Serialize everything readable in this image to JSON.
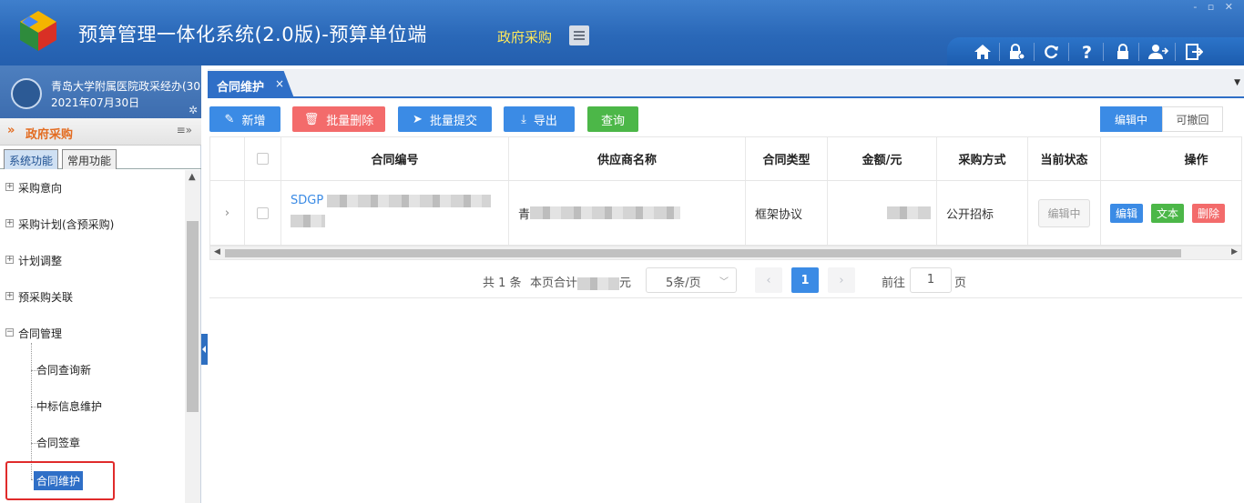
{
  "header": {
    "app_title": "预算管理一体化系统(2.0版)-预算单位端",
    "module_name": "政府采购",
    "window_controls": "- ▫ ✕",
    "toolbar_icons": [
      "home-icon",
      "lock-settings-icon",
      "refresh-icon",
      "help-icon",
      "lock-icon",
      "user-switch-icon",
      "logout-icon"
    ]
  },
  "sidebar": {
    "user_name": "青岛大学附属医院政采经办(30",
    "user_date": "2021年07月30日",
    "section_title": "政府采购",
    "tabs": [
      "系统功能",
      "常用功能"
    ],
    "tree": [
      {
        "label": "采购意向",
        "expanded": false
      },
      {
        "label": "采购计划(含预采购)",
        "expanded": false
      },
      {
        "label": "计划调整",
        "expanded": false
      },
      {
        "label": "预采购关联",
        "expanded": false
      },
      {
        "label": "合同管理",
        "expanded": true
      }
    ],
    "children": [
      "合同查询新",
      "中标信息维护",
      "合同签章",
      "合同维护"
    ],
    "selected_child": "合同维护"
  },
  "tabs": {
    "active_label": "合同维护",
    "close_glyph": "×"
  },
  "toolbar": {
    "add_label": "新增",
    "batch_delete_label": "批量删除",
    "batch_submit_label": "批量提交",
    "export_label": "导出",
    "query_label": "查询",
    "status_filters": [
      "编辑中",
      "可撤回"
    ],
    "active_filter": "编辑中"
  },
  "table": {
    "headers": [
      "合同编号",
      "供应商名称",
      "合同类型",
      "金额/元",
      "采购方式",
      "当前状态",
      "操作"
    ],
    "rows": [
      {
        "contract_no": "SDGP",
        "supplier": "青",
        "type": "框架协议",
        "amount": "",
        "method": "公开招标",
        "status": "编辑中",
        "ops": [
          "编辑",
          "文本",
          "删除"
        ]
      }
    ]
  },
  "pager": {
    "total": "共 1 条",
    "page_sum_prefix": "本页合计",
    "page_sum_suffix": "元",
    "page_size": "5条/页",
    "current_page": "1",
    "goto_label": "前往",
    "goto_value": "1",
    "page_unit": "页"
  },
  "colors": {
    "header_blue": "#2a68b8",
    "accent_blue": "#3b8be5",
    "danger_red": "#f36b6b",
    "success_green": "#4cb748",
    "module_yellow": "#ffe95a",
    "highlight_red": "#e02b2b"
  }
}
